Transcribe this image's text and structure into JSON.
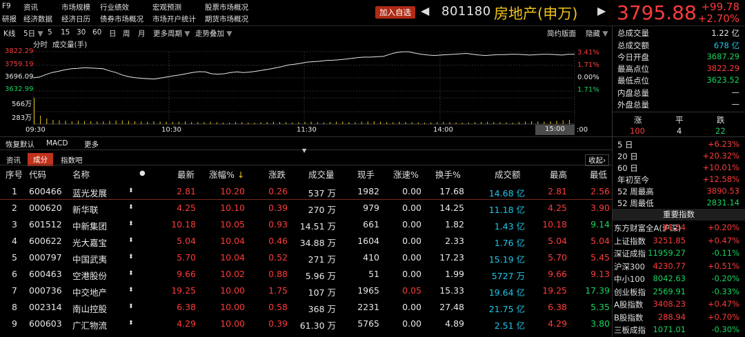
{
  "menu": {
    "row1": [
      "F9",
      "资讯",
      "市场规模",
      "行业绩效",
      "宏观预测",
      "股票市场概况"
    ],
    "row2": [
      "研报",
      "经济数据",
      "经济日历",
      "债券市场概况",
      "市场开户统计",
      "期货市场概况"
    ]
  },
  "header": {
    "add_favorite": "加入自选",
    "code": "801180",
    "name": "房地产(申万)",
    "price": "3795.88",
    "change": "+99.78",
    "change_pct": "+2.70%"
  },
  "toolbar": {
    "kline": "K线",
    "period_sel": "5日",
    "p5": "5",
    "p15": "15",
    "p30": "30",
    "p60": "60",
    "day": "日",
    "week": "周",
    "month": "月",
    "more_periods": "更多周期",
    "overlay": "走势叠加",
    "simple_layout": "简约版面",
    "hide": "隐藏"
  },
  "chart_header": {
    "fenshi": "分时",
    "volume_label": "成交量(手)"
  },
  "chart_data": {
    "type": "line",
    "x_ticks": [
      "09:30",
      "10:30",
      "11:30",
      "14:00",
      "15:00"
    ],
    "y_left_ticks": [
      "3822.29",
      "3759.19",
      "3696.09",
      "3632.99"
    ],
    "y_right_ticks": [
      "3.41%",
      "1.71%",
      "0.00%",
      "1.71%"
    ],
    "volume_ticks": [
      "566万",
      "283万"
    ],
    "ylim": [
      3632.99,
      3822.29
    ],
    "baseline": 3696.09,
    "prices": [
      3696,
      3700,
      3712,
      3722,
      3728,
      3735,
      3740,
      3742,
      3745,
      3744,
      3742,
      3740,
      3730,
      3722,
      3710,
      3702,
      3697,
      3694,
      3692,
      3690,
      3695,
      3700,
      3706,
      3710,
      3716,
      3722,
      3726,
      3725,
      3716,
      3714,
      3716,
      3722,
      3725,
      3722,
      3724,
      3728,
      3733,
      3738,
      3744,
      3750,
      3758,
      3762,
      3766,
      3772,
      3774,
      3776,
      3780,
      3781,
      3783,
      3786,
      3790,
      3794,
      3796,
      3796,
      3798,
      3800,
      3810,
      3818,
      3822,
      3822,
      3815,
      3810,
      3806,
      3804,
      3806,
      3808,
      3810,
      3812,
      3814,
      3810,
      3806,
      3804,
      3806,
      3808,
      3808,
      3810,
      3810,
      3808,
      3806,
      3808,
      3810,
      3810,
      3808,
      3806,
      3810,
      3810
    ],
    "volumes": [
      566,
      180,
      120,
      90,
      80,
      70,
      60,
      70,
      65,
      60,
      55,
      60,
      70,
      75,
      80,
      70,
      60,
      55,
      50,
      60,
      55,
      50,
      45,
      50,
      55,
      45,
      40,
      45,
      50,
      40,
      35,
      30,
      45,
      40,
      35,
      30,
      40,
      45,
      50,
      45,
      40,
      35,
      40,
      45,
      50,
      40,
      35,
      45,
      50,
      55,
      45,
      40,
      50,
      55,
      60,
      50,
      45,
      40,
      50,
      45,
      40,
      35,
      30,
      35,
      40,
      45,
      40,
      35,
      30,
      35,
      40,
      45,
      50,
      45,
      40,
      35,
      30,
      45,
      50,
      60,
      55,
      50,
      60,
      70,
      80,
      90
    ]
  },
  "chart_bottom": {
    "restore": "恢复默认",
    "macd": "MACD",
    "more": "更多"
  },
  "bottom_tabs": {
    "zixun": "资讯",
    "chengfen": "成分",
    "zhishuba": "指数吧",
    "collapse": "收起"
  },
  "table": {
    "headers": [
      "序号",
      "代码",
      "名称",
      "●",
      "最新",
      "涨幅%",
      "涨跌",
      "成交量",
      "现手",
      "涨速%",
      "换手%",
      "成交额",
      "最高",
      "最低"
    ],
    "sort_arrow": "↓",
    "rows": [
      {
        "no": "1",
        "code": "600466",
        "name": "蓝光发展",
        "last": "2.81",
        "pct": "10.20",
        "chg": "0.26",
        "vol": "537 万",
        "hand": "1982",
        "speed": "0.00",
        "turn": "17.68",
        "amt": "14.68 亿",
        "high": "2.81",
        "low": "2.56"
      },
      {
        "no": "2",
        "code": "000620",
        "name": "新华联",
        "last": "4.25",
        "pct": "10.10",
        "chg": "0.39",
        "vol": "270 万",
        "hand": "979",
        "speed": "0.00",
        "turn": "14.25",
        "amt": "11.18 亿",
        "high": "4.25",
        "low": "3.90"
      },
      {
        "no": "3",
        "code": "601512",
        "name": "中新集团",
        "last": "10.18",
        "pct": "10.05",
        "chg": "0.93",
        "vol": "14.51 万",
        "hand": "661",
        "speed": "0.00",
        "turn": "1.82",
        "amt": "1.43 亿",
        "high": "10.18",
        "low": "9.14"
      },
      {
        "no": "4",
        "code": "600622",
        "name": "光大嘉宝",
        "last": "5.04",
        "pct": "10.04",
        "chg": "0.46",
        "vol": "34.88 万",
        "hand": "1604",
        "speed": "0.00",
        "turn": "2.33",
        "amt": "1.76 亿",
        "high": "5.04",
        "low": "5.04"
      },
      {
        "no": "5",
        "code": "000797",
        "name": "中国武夷",
        "last": "5.70",
        "pct": "10.04",
        "chg": "0.52",
        "vol": "271 万",
        "hand": "410",
        "speed": "0.00",
        "turn": "17.23",
        "amt": "15.19 亿",
        "high": "5.70",
        "low": "5.45"
      },
      {
        "no": "6",
        "code": "600463",
        "name": "空港股份",
        "last": "9.66",
        "pct": "10.02",
        "chg": "0.88",
        "vol": "5.96 万",
        "hand": "51",
        "speed": "0.00",
        "turn": "1.99",
        "amt": "5727 万",
        "high": "9.66",
        "low": "9.13"
      },
      {
        "no": "7",
        "code": "000736",
        "name": "中交地产",
        "last": "19.25",
        "pct": "10.00",
        "chg": "1.75",
        "vol": "107 万",
        "hand": "1965",
        "speed": "0.05",
        "turn": "15.33",
        "amt": "19.64 亿",
        "high": "19.25",
        "low": "17.39"
      },
      {
        "no": "8",
        "code": "002314",
        "name": "南山控股",
        "last": "6.38",
        "pct": "10.00",
        "chg": "0.58",
        "vol": "368 万",
        "hand": "2231",
        "speed": "0.00",
        "turn": "27.48",
        "amt": "21.75 亿",
        "high": "6.38",
        "low": "5.35"
      },
      {
        "no": "9",
        "code": "600603",
        "name": "广汇物流",
        "last": "4.29",
        "pct": "10.00",
        "chg": "0.39",
        "vol": "61.30 万",
        "hand": "5765",
        "speed": "0.00",
        "turn": "4.89",
        "amt": "2.51 亿",
        "high": "4.29",
        "low": "3.80"
      }
    ]
  },
  "stats": {
    "total_volume_l": "总成交量",
    "total_volume": "1.22 亿",
    "total_amount_l": "总成交额",
    "total_amount": "678 亿",
    "open_l": "今日开盘",
    "open": "3687.29",
    "high_l": "最高点位",
    "high": "3822.29",
    "low_l": "最低点位",
    "low": "3623.52",
    "inner_l": "内盘总量",
    "inner": "—",
    "outer_l": "外盘总量",
    "outer": "—"
  },
  "breadth": {
    "up_l": "涨",
    "flat_l": "平",
    "down_l": "跌",
    "up": "100",
    "flat": "4",
    "down": "22"
  },
  "perf": [
    {
      "label": "5 日",
      "value": "+6.23%"
    },
    {
      "label": "20 日",
      "value": "+20.32%"
    },
    {
      "label": "60 日",
      "value": "+10.01%"
    },
    {
      "label": "年初至今",
      "value": "+12.58%"
    },
    {
      "label": "52 周最高",
      "value": "3890.53"
    },
    {
      "label": "52 周最低",
      "value": "2831.14"
    }
  ],
  "indices_title": "重要指数",
  "indices": [
    {
      "name": "东方财富全A(沪深)",
      "value": "81.54",
      "pct": "+0.20%",
      "dir": "up"
    },
    {
      "name": "上证指数",
      "value": "3251.85",
      "pct": "+0.47%",
      "dir": "up"
    },
    {
      "name": "深证成指",
      "value": "11959.27",
      "pct": "-0.11%",
      "dir": "down"
    },
    {
      "name": "沪深300",
      "value": "4230.77",
      "pct": "+0.51%",
      "dir": "up"
    },
    {
      "name": "中小100",
      "value": "8042.63",
      "pct": "-0.20%",
      "dir": "down"
    },
    {
      "name": "创业板指",
      "value": "2569.91",
      "pct": "-0.33%",
      "dir": "down"
    },
    {
      "name": "A股指数",
      "value": "3408.23",
      "pct": "+0.47%",
      "dir": "up"
    },
    {
      "name": "B股指数",
      "value": "288.94",
      "pct": "+0.70%",
      "dir": "up"
    },
    {
      "name": "三板成指",
      "value": "1071.01",
      "pct": "-0.30%",
      "dir": "down"
    }
  ]
}
